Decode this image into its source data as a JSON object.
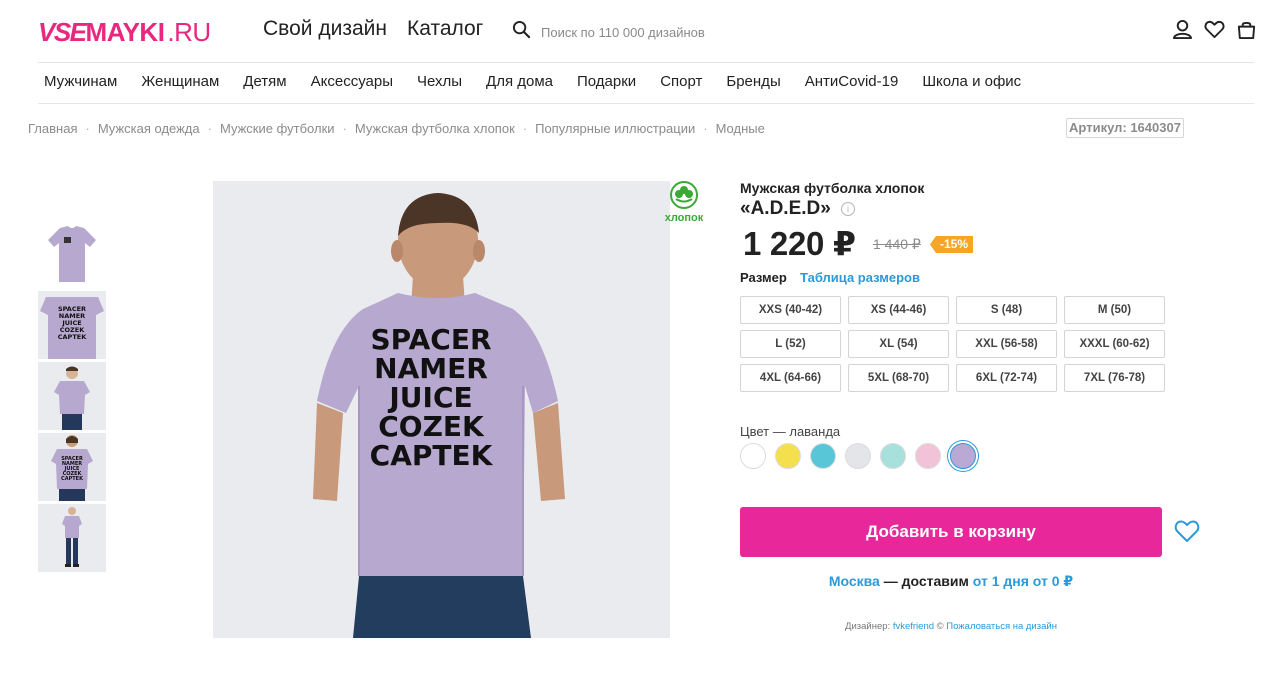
{
  "header": {
    "logo_part1": "VSE",
    "logo_part2": "MAYKI",
    "logo_part3": ".RU",
    "link_design": "Свой дизайн",
    "link_catalog": "Каталог",
    "search_placeholder": "Поиск по 110 000 дизайнов"
  },
  "nav": [
    "Мужчинам",
    "Женщинам",
    "Детям",
    "Аксессуары",
    "Чехлы",
    "Для дома",
    "Подарки",
    "Спорт",
    "Бренды",
    "АнтиCovid-19",
    "Школа и офис"
  ],
  "breadcrumb": [
    "Главная",
    "Мужская одежда",
    "Мужские футболки",
    "Мужская футболка хлопок",
    "Популярные иллюстрации",
    "Модные"
  ],
  "article": "Артикул: 1640307",
  "gallery": {
    "badge": "хлопок",
    "shirt_text": [
      "SPACER",
      "NAMER",
      "JUICE",
      "COZEK",
      "CAPTEK"
    ],
    "shirt_color": "#b7a8cf"
  },
  "product": {
    "title_line1": "Мужская футболка хлопок",
    "title_line2": "«A.D.E.D»",
    "info_icon": "i",
    "price": "1 220 ₽",
    "old_price": "1 440 ₽",
    "discount": "-15%",
    "size_label": "Размер",
    "size_table_link": "Таблица размеров",
    "sizes": [
      "XXS (40-42)",
      "XS (44-46)",
      "S (48)",
      "M (50)",
      "L (52)",
      "XL (54)",
      "XXL (56-58)",
      "XXXL (60-62)",
      "4XL (64-66)",
      "5XL (68-70)",
      "6XL (72-74)",
      "7XL (76-78)"
    ],
    "color_label": "Цвет — лаванда",
    "colors": [
      "#ffffff",
      "#f4e04d",
      "#58c6d6",
      "#e3e5e8",
      "#a8e0dc",
      "#f1c2d8",
      "#b9a9d4"
    ],
    "selected_color_index": 6,
    "add_to_cart": "Добавить в корзину",
    "delivery_city": "Москва",
    "delivery_mid": " — доставим ",
    "delivery_when": "от 1 дня от 0 ₽",
    "designer_prefix": "Дизайнер: ",
    "designer_name": "fvkefriend",
    "designer_copy": " © ",
    "complaint": "Пожаловаться на дизайн"
  },
  "colors": {
    "brand": "#e8277f",
    "cart_button": "#e8279a",
    "link": "#2a9ad8",
    "discount": "#f5a623"
  }
}
